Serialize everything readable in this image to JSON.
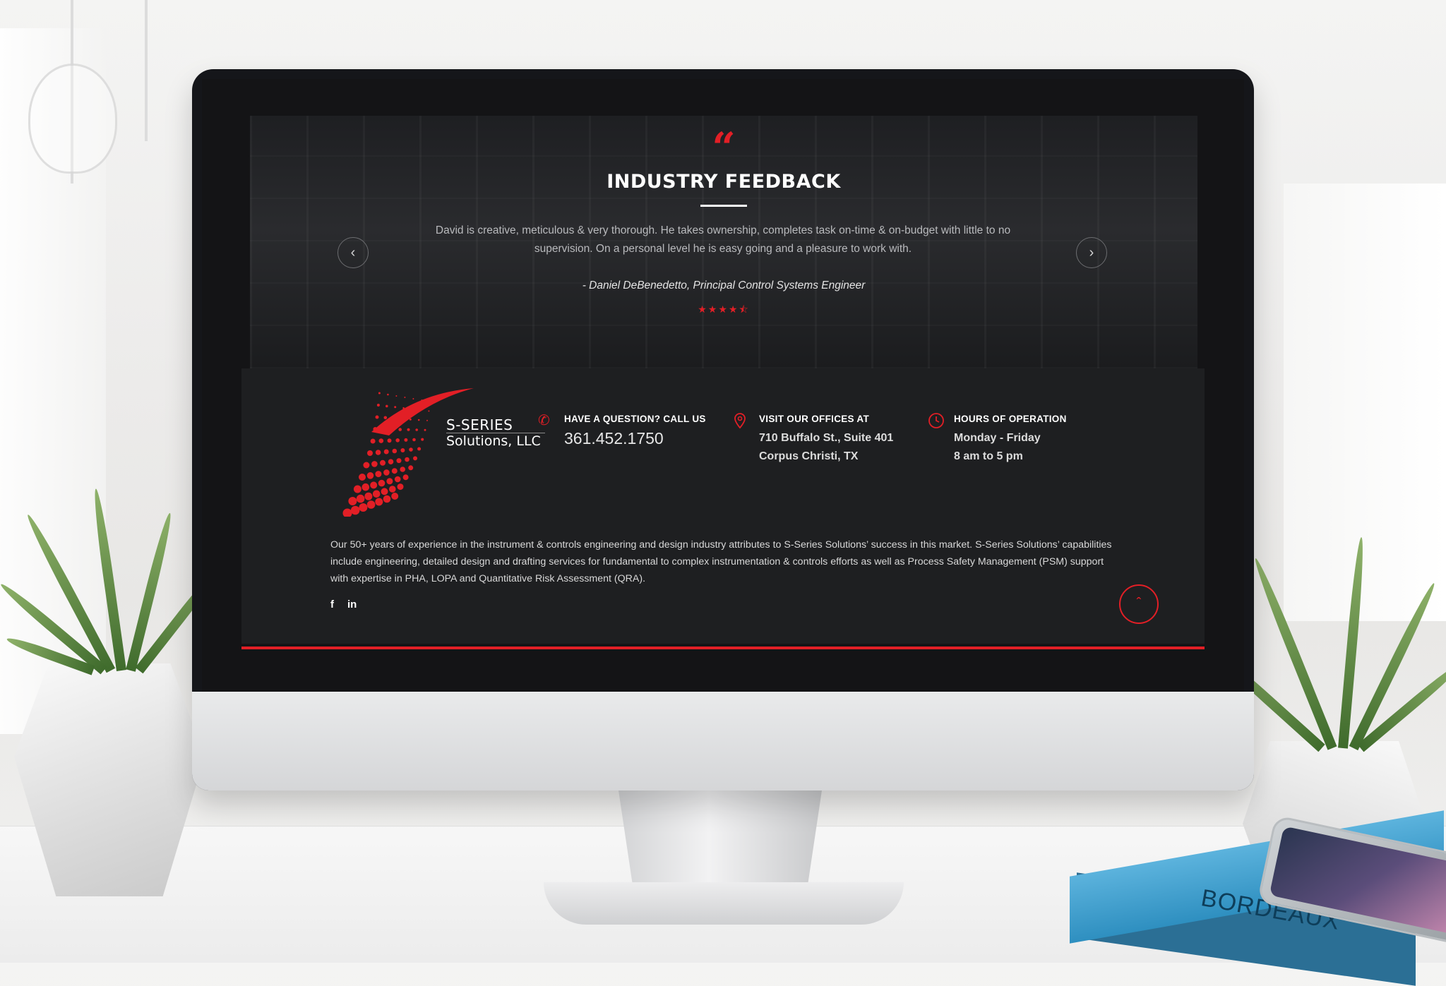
{
  "hero": {
    "quote_icon": "quote-icon",
    "title": "INDUSTRY FEEDBACK",
    "testimonial": "David is creative, meticulous & very thorough. He takes ownership, completes task on-time & on-budget with little to no supervision. On a personal level he is easy going and a pleasure to work with.",
    "author": "- Daniel DeBenedetto, Principal Control Systems Engineer",
    "rating": 4.5,
    "rating_max": 5,
    "prev_icon": "chevron-left-icon",
    "next_icon": "chevron-right-icon"
  },
  "logo": {
    "line1": "S-SERIES",
    "line2": "Solutions, LLC"
  },
  "contact": {
    "phone_heading": "HAVE A QUESTION? CALL US",
    "phone_number": "361.452.1750",
    "office_heading": "VISIT OUR OFFICES AT",
    "office_line1": "710 Buffalo St., Suite 401",
    "office_line2": "Corpus Christi, TX",
    "hours_heading": "HOURS OF OPERATION",
    "hours_line1": "Monday - Friday",
    "hours_line2": "8 am to 5 pm"
  },
  "about": "Our 50+ years of experience in the instrument & controls engineering and design industry attributes to S-Series Solutions’ success in this market. S-Series Solutions’ capabilities include engineering, detailed design and drafting services for fundamental to complex instrumentation & controls efforts as well as Process Safety Management (PSM) support with expertise in PHA, LOPA and Quantitative Risk Assessment (QRA).",
  "social": {
    "facebook": "f",
    "linkedin": "in"
  },
  "colors": {
    "accent": "#e21f26",
    "footer_bg": "#1e1f21",
    "screen_bg": "#141416"
  },
  "scene": {
    "book_title": "BORDEAUX"
  }
}
